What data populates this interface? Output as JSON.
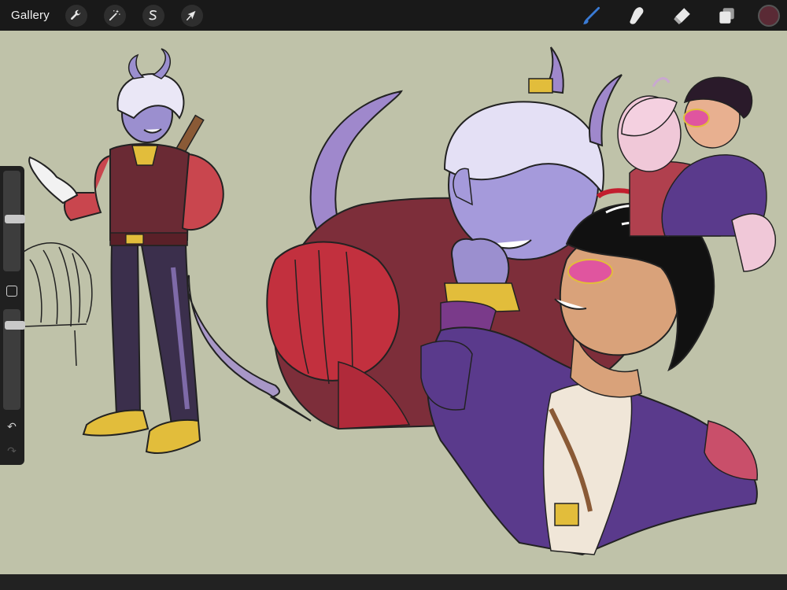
{
  "toolbar": {
    "gallery_label": "Gallery",
    "left_tools": [
      {
        "name": "actions",
        "icon": "wrench-icon"
      },
      {
        "name": "adjustments",
        "icon": "magic-wand-icon"
      },
      {
        "name": "selection",
        "icon": "selection-s-icon"
      },
      {
        "name": "transform",
        "icon": "arrow-cursor-icon"
      }
    ],
    "right_tools": [
      {
        "name": "brush",
        "icon": "brush-icon",
        "active": true
      },
      {
        "name": "smudge",
        "icon": "smudge-icon"
      },
      {
        "name": "eraser",
        "icon": "eraser-icon"
      },
      {
        "name": "layers",
        "icon": "layers-icon"
      }
    ],
    "current_color": "#5a2a35",
    "active_tool_color": "#3a7bd5"
  },
  "sidebar": {
    "brush_size": 0.52,
    "opacity": 0.87
  },
  "canvas": {
    "background": "#bfc2a9"
  }
}
